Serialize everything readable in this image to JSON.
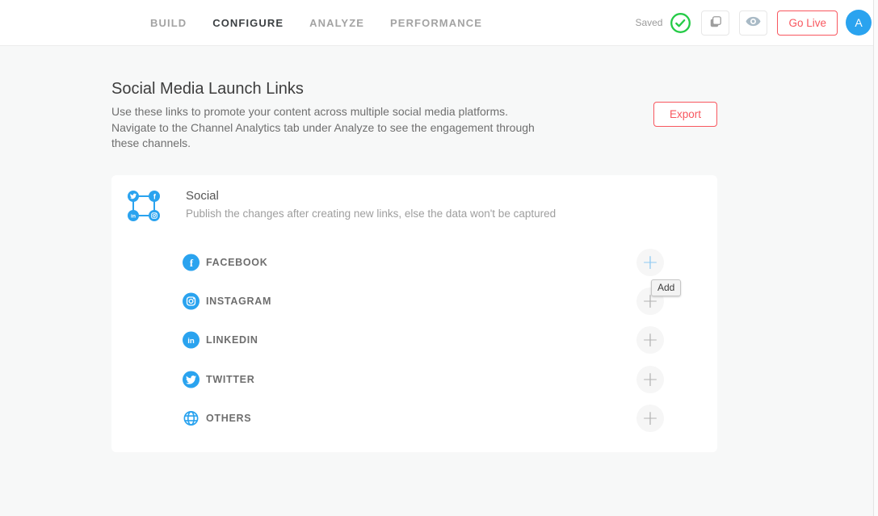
{
  "header": {
    "nav": [
      {
        "label": "BUILD",
        "active": false
      },
      {
        "label": "CONFIGURE",
        "active": true
      },
      {
        "label": "ANALYZE",
        "active": false
      },
      {
        "label": "PERFORMANCE",
        "active": false
      }
    ],
    "saved_label": "Saved",
    "status_icon": "check-circle-icon",
    "icon_buttons": [
      {
        "icon": "layers-icon"
      },
      {
        "icon": "eye-icon"
      }
    ],
    "go_live_label": "Go Live",
    "avatar_letter": "A"
  },
  "page": {
    "title": "Social Media Launch Links",
    "description": "Use these links to promote your content across multiple social media platforms. Navigate to the Channel Analytics tab under Analyze to see the engagement through these channels.",
    "export_label": "Export"
  },
  "card": {
    "title": "Social",
    "subtitle": "Publish the changes after creating new links, else the data won't be captured",
    "section_icon": "social-network-cluster-icon",
    "platforms": [
      {
        "label": "FACEBOOK",
        "icon": "facebook-icon"
      },
      {
        "label": "INSTAGRAM",
        "icon": "instagram-icon"
      },
      {
        "label": "LINKEDIN",
        "icon": "linkedin-icon"
      },
      {
        "label": "TWITTER",
        "icon": "twitter-icon"
      },
      {
        "label": "OTHERS",
        "icon": "globe-icon"
      }
    ],
    "add_button_glyph": "+",
    "tooltip_label": "Add"
  },
  "colors": {
    "accent_blue": "#2aa3ef",
    "danger_red": "#f8575f",
    "success_green": "#24cb46",
    "inactive_gray": "#a3a3a3",
    "card_bg": "#ffffff",
    "page_bg": "#f7f8f8"
  }
}
